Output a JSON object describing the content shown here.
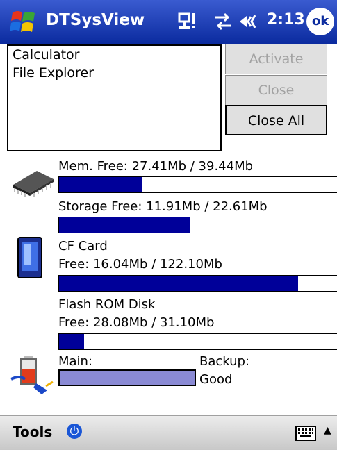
{
  "titlebar": {
    "app_title": "DTSysView",
    "time": "2:13",
    "ok_label": "ok"
  },
  "tasks": [
    "Calculator",
    "File Explorer"
  ],
  "buttons": {
    "activate": "Activate",
    "close": "Close",
    "close_all": "Close All"
  },
  "memory": {
    "label": "Mem. Free: 27.41Mb / 39.44Mb",
    "fill_fraction": 0.3
  },
  "storage": {
    "label": "Storage Free: 11.91Mb / 22.61Mb",
    "fill_fraction": 0.47
  },
  "cf_card": {
    "name": "CF Card",
    "free": "Free: 16.04Mb / 122.10Mb",
    "fill_fraction": 0.86
  },
  "flash": {
    "name": "Flash ROM Disk",
    "free": "Free: 28.08Mb / 31.10Mb",
    "fill_fraction": 0.09
  },
  "battery": {
    "main_label": "Main:",
    "backup_label": "Backup:",
    "backup_status": "Good",
    "main_fill_fraction": 1.0
  },
  "bottom": {
    "tools_label": "Tools"
  },
  "colors": {
    "titlebar": "#0a2a9e",
    "bar_fill": "#000099",
    "battery_fill": "#8a8ad4"
  }
}
